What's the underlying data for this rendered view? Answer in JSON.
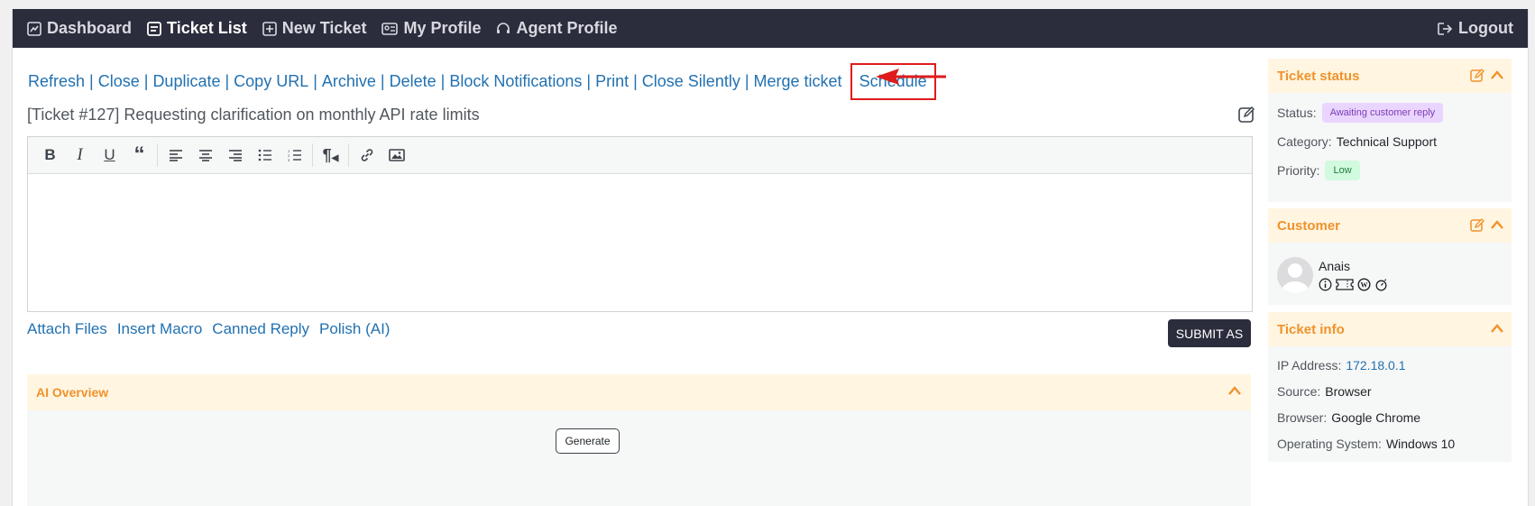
{
  "nav": {
    "items": [
      {
        "label": "Dashboard",
        "icon": "dashboard-icon"
      },
      {
        "label": "Ticket List",
        "icon": "ticket-list-icon"
      },
      {
        "label": "New Ticket",
        "icon": "plus-square-icon"
      },
      {
        "label": "My Profile",
        "icon": "profile-card-icon"
      },
      {
        "label": "Agent Profile",
        "icon": "headset-icon"
      }
    ],
    "logout": "Logout"
  },
  "actions": [
    "Refresh",
    "Close",
    "Duplicate",
    "Copy URL",
    "Archive",
    "Delete",
    "Block Notifications",
    "Print",
    "Close Silently",
    "Merge ticket",
    "Schedule"
  ],
  "ticket": {
    "title": "[Ticket #127] Requesting clarification on monthly API rate limits"
  },
  "editor": {
    "tools": [
      "bold",
      "italic",
      "underline",
      "blockquote",
      "align-left",
      "align-center",
      "align-right",
      "bullet-list",
      "numbered-list",
      "paragraph-direction",
      "link",
      "image"
    ]
  },
  "reply_links": [
    "Attach Files",
    "Insert Macro",
    "Canned Reply",
    "Polish (AI)"
  ],
  "submit_label": "SUBMIT AS",
  "ai_overview": {
    "title": "AI Overview",
    "generate_label": "Generate"
  },
  "ticket_status": {
    "title": "Ticket status",
    "status_label": "Status:",
    "status_value": "Awaiting customer reply",
    "category_label": "Category:",
    "category_value": "Technical Support",
    "priority_label": "Priority:",
    "priority_value": "Low"
  },
  "customer": {
    "title": "Customer",
    "name": "Anais"
  },
  "ticket_info": {
    "title": "Ticket info",
    "ip_label": "IP Address:",
    "ip_value": "172.18.0.1",
    "source_label": "Source:",
    "source_value": "Browser",
    "browser_label": "Browser:",
    "browser_value": "Google Chrome",
    "os_label": "Operating System:",
    "os_value": "Windows 10"
  },
  "colors": {
    "nav_bg": "#2b2d3d",
    "link": "#2271b1",
    "accent": "#f0922b",
    "highlight": "#e01b1b"
  }
}
